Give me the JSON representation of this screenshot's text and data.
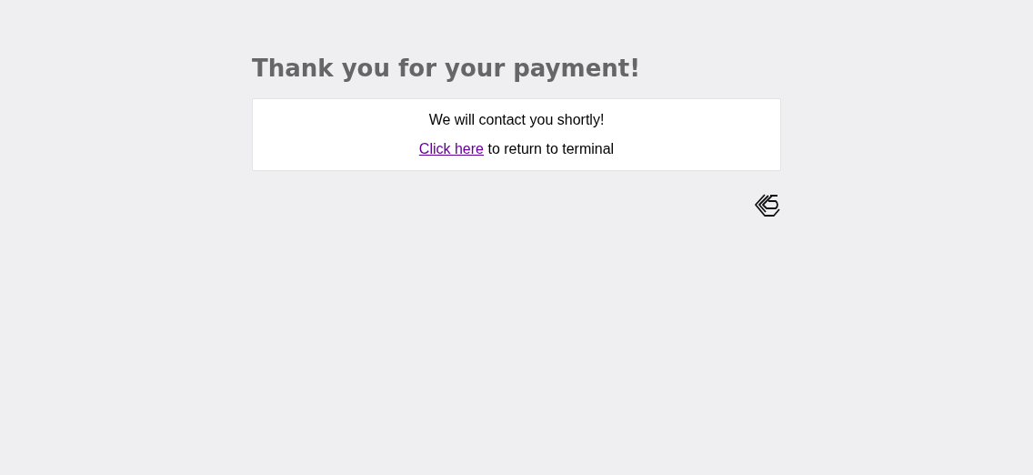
{
  "heading": "Thank you for your payment!",
  "message": "We will contact you shortly!",
  "return_line": {
    "link": "Click here",
    "text": " to return to terminal"
  }
}
